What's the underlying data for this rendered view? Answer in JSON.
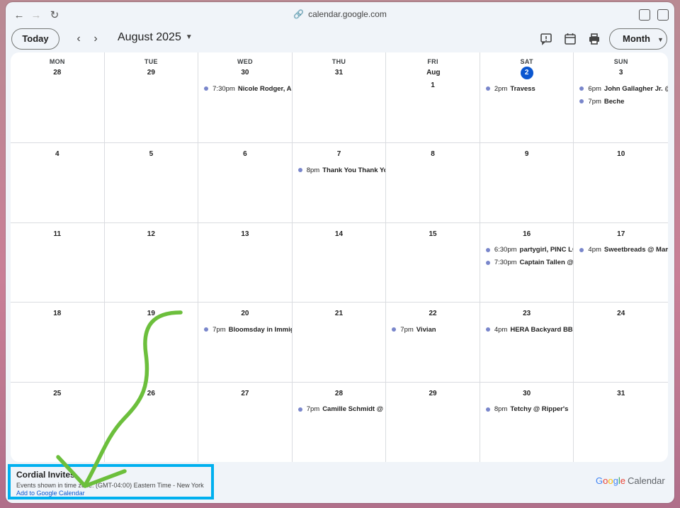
{
  "browser": {
    "url": "calendar.google.com",
    "icons": [
      "back-icon",
      "forward-icon",
      "reload-icon",
      "lock-icon",
      "extension-icon",
      "sidebar-icon"
    ]
  },
  "header": {
    "today_label": "Today",
    "month_title": "August 2025",
    "view_label": "Month",
    "icons": [
      "feedback-icon",
      "calendar-icon",
      "print-icon"
    ]
  },
  "weekdays": [
    "MON",
    "TUE",
    "WED",
    "THU",
    "FRI",
    "SAT",
    "SUN"
  ],
  "weeks": [
    [
      {
        "day": "28",
        "events": []
      },
      {
        "day": "29",
        "events": []
      },
      {
        "day": "30",
        "events": [
          {
            "time": "7:30pm",
            "title": "Nicole Rodger, Ale"
          }
        ]
      },
      {
        "day": "31",
        "events": []
      },
      {
        "day": "Aug 1",
        "events": []
      },
      {
        "day": "2",
        "today": true,
        "events": [
          {
            "time": "2pm",
            "title": "Travess"
          }
        ]
      },
      {
        "day": "3",
        "events": [
          {
            "time": "6pm",
            "title": "John Gallagher Jr. @"
          },
          {
            "time": "7pm",
            "title": "Beche"
          }
        ]
      }
    ],
    [
      {
        "day": "4",
        "events": []
      },
      {
        "day": "5",
        "events": []
      },
      {
        "day": "6",
        "events": []
      },
      {
        "day": "7",
        "events": [
          {
            "time": "8pm",
            "title": "Thank You Thank You"
          }
        ]
      },
      {
        "day": "8",
        "events": []
      },
      {
        "day": "9",
        "events": []
      },
      {
        "day": "10",
        "events": []
      }
    ],
    [
      {
        "day": "11",
        "events": []
      },
      {
        "day": "12",
        "events": []
      },
      {
        "day": "13",
        "events": []
      },
      {
        "day": "14",
        "events": []
      },
      {
        "day": "15",
        "events": []
      },
      {
        "day": "16",
        "events": [
          {
            "time": "6:30pm",
            "title": "partygirl, PINC LC"
          },
          {
            "time": "7:30pm",
            "title": "Captain Tallen @ C"
          }
        ]
      },
      {
        "day": "17",
        "events": [
          {
            "time": "4pm",
            "title": "Sweetbreads @ Mam"
          }
        ]
      }
    ],
    [
      {
        "day": "18",
        "events": []
      },
      {
        "day": "19",
        "events": []
      },
      {
        "day": "20",
        "events": [
          {
            "time": "7pm",
            "title": "Bloomsday in Immigr"
          }
        ]
      },
      {
        "day": "21",
        "events": []
      },
      {
        "day": "22",
        "events": [
          {
            "time": "7pm",
            "title": "Vivian"
          }
        ]
      },
      {
        "day": "23",
        "events": [
          {
            "time": "4pm",
            "title": "HERA Backyard BBQ"
          }
        ]
      },
      {
        "day": "24",
        "events": []
      }
    ],
    [
      {
        "day": "25",
        "events": []
      },
      {
        "day": "26",
        "events": []
      },
      {
        "day": "27",
        "events": []
      },
      {
        "day": "28",
        "events": [
          {
            "time": "7pm",
            "title": "Camille Schmidt @ N"
          }
        ]
      },
      {
        "day": "29",
        "events": []
      },
      {
        "day": "30",
        "events": [
          {
            "time": "8pm",
            "title": "Tetchy @ Ripper's"
          }
        ]
      },
      {
        "day": "31",
        "events": []
      }
    ]
  ],
  "footer": {
    "calendar_name": "Cordial Invites",
    "timezone_text": "Events shown in time zone: (GMT-04:00) Eastern Time - New York",
    "add_link": "Add to Google Calendar",
    "brand_g1": "G",
    "brand_g2": "o",
    "brand_g3": "o",
    "brand_g4": "g",
    "brand_g5": "l",
    "brand_g6": "e",
    "brand_suffix": "Calendar"
  },
  "colors": {
    "accent": "#0b57d0",
    "event_dot": "#7986cb",
    "highlight_box": "#00b0ef",
    "annotation_stroke": "#6cbf3c"
  }
}
